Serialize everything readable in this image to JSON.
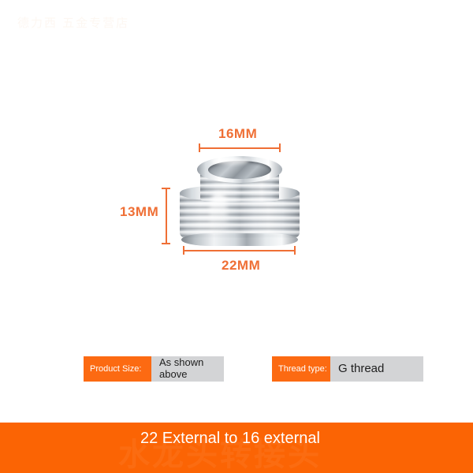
{
  "page": {
    "background_color": "#ffffff",
    "accent_color": "#fb6404",
    "dimension_color": "#ef6f35",
    "chip_value_bg": "#d3d4d6",
    "watermark_text": "德力西 五金专营店"
  },
  "product": {
    "name": "chrome-faucet-thread-adapter",
    "finish": "polished chrome"
  },
  "dimensions": {
    "top": {
      "label": "16MM",
      "axis": "horizontal"
    },
    "left": {
      "label": "13MM",
      "axis": "vertical"
    },
    "bottom": {
      "label": "22MM",
      "axis": "horizontal"
    }
  },
  "specs": [
    {
      "key": "Product Size:",
      "value": "As shown above"
    },
    {
      "key": "Thread type:",
      "value": "G thread"
    }
  ],
  "banner": {
    "text": "22 External to 16 external",
    "watermark": "水龙头转接头"
  }
}
